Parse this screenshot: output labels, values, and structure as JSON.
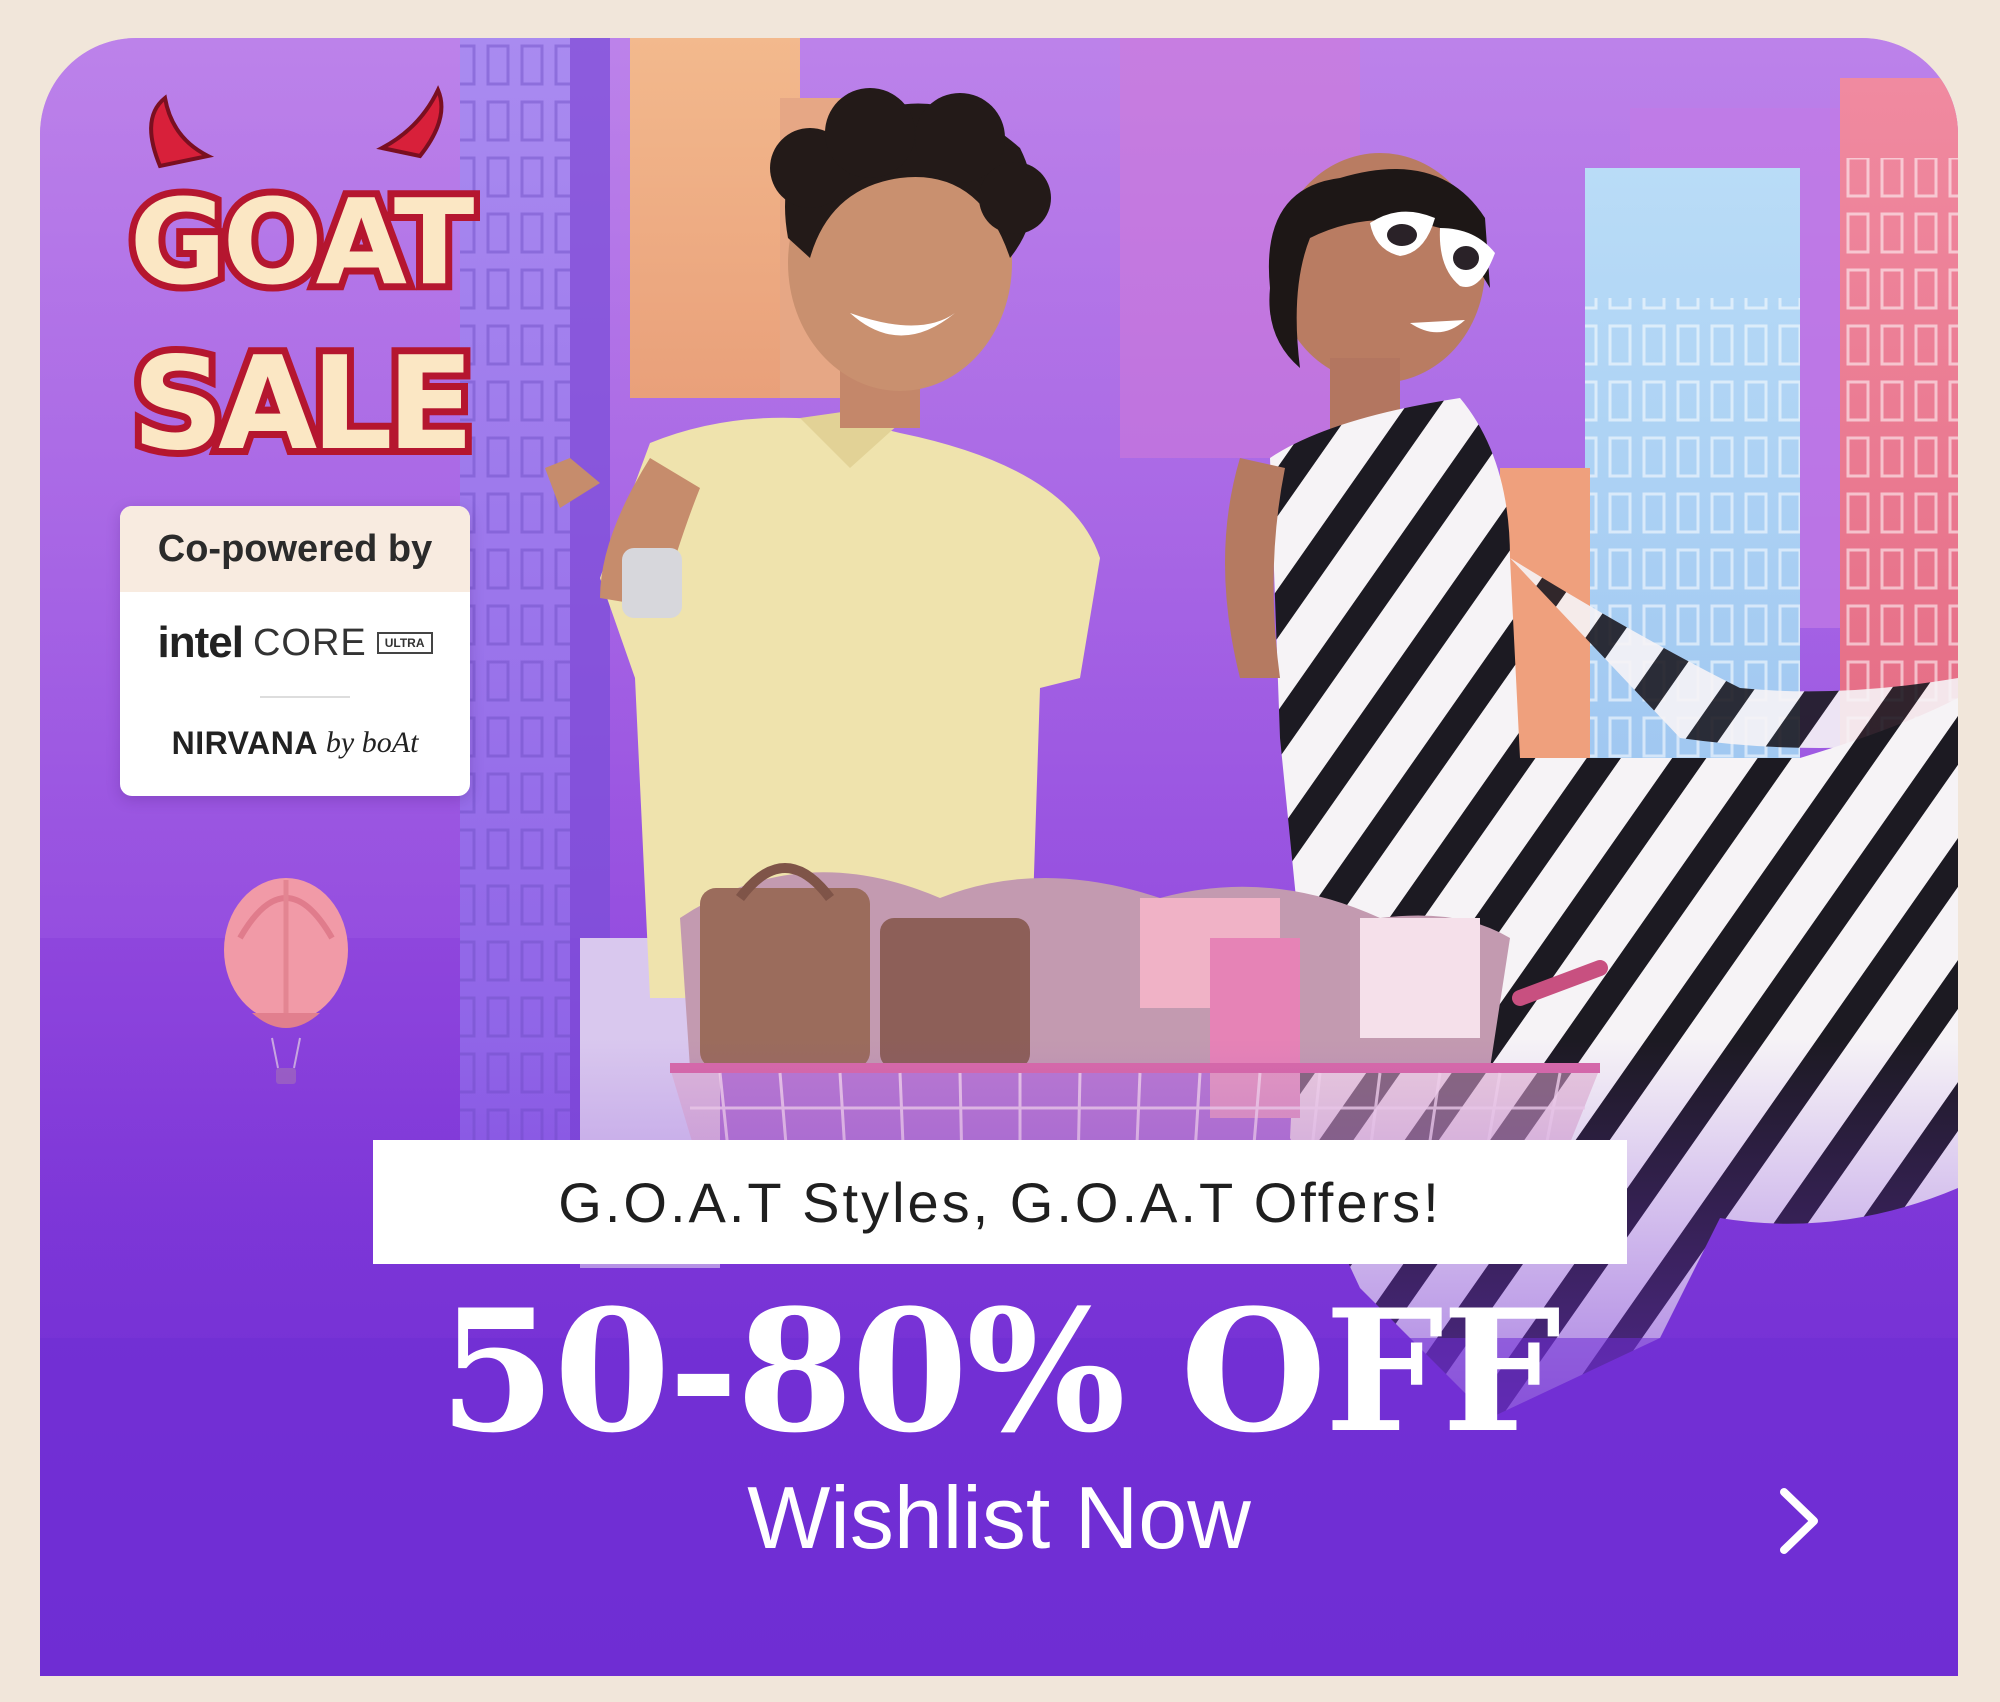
{
  "banner": {
    "logo": {
      "line1": "GOAT",
      "line2": "SALE"
    },
    "sponsors": {
      "heading": "Co-powered by",
      "intel": {
        "brand": "intel",
        "product": "CORE",
        "tier": "ULTRA"
      },
      "nirvana": {
        "name": "NIRVANA",
        "suffix": "by boAt"
      }
    },
    "tagline": "G.O.A.T Styles, G.O.A.T Offers!",
    "offer": "50-80% OFF",
    "cta": "Wishlist Now",
    "next_icon": "chevron-right-icon"
  },
  "colors": {
    "background": "#f1e6da",
    "banner_top": "#b277ea",
    "banner_bottom": "#6f2ed3",
    "logo_red": "#d8203a",
    "logo_cream": "#fbe7c4"
  }
}
